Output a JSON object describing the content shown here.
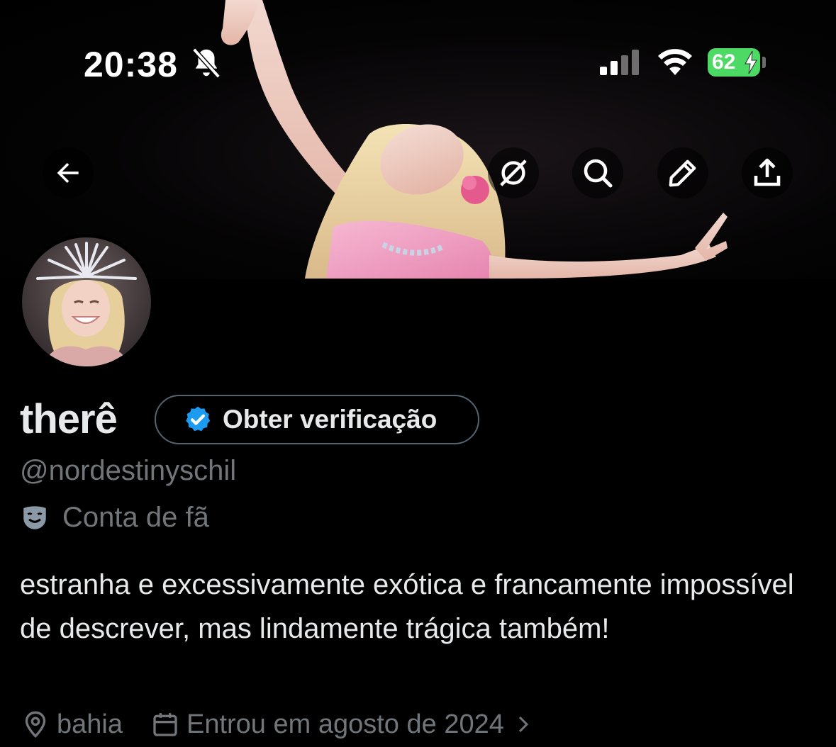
{
  "status_bar": {
    "time": "20:38",
    "battery": "62",
    "icons": [
      "bell-muted-icon",
      "cellular-signal-icon",
      "wifi-icon",
      "battery-charging-icon"
    ]
  },
  "header": {
    "buttons": [
      "back-arrow-icon",
      "grok-icon",
      "search-icon",
      "pencil-icon",
      "share-icon"
    ]
  },
  "profile": {
    "display_name": "therê",
    "verify_button_label": "Obter verificação",
    "handle": "@nordestinyschil",
    "category": "Conta de fã",
    "bio": "estranha e excessivamente exótica e francamente impossível de descrever, mas lindamente trágica também!",
    "location": "bahia",
    "joined": "Entrou em agosto de 2024"
  },
  "colors": {
    "background": "#000000",
    "primary_text": "#e7e9ea",
    "secondary_text": "#71767b",
    "verified_blue": "#1d9bf0",
    "battery_green": "#4cd964"
  }
}
